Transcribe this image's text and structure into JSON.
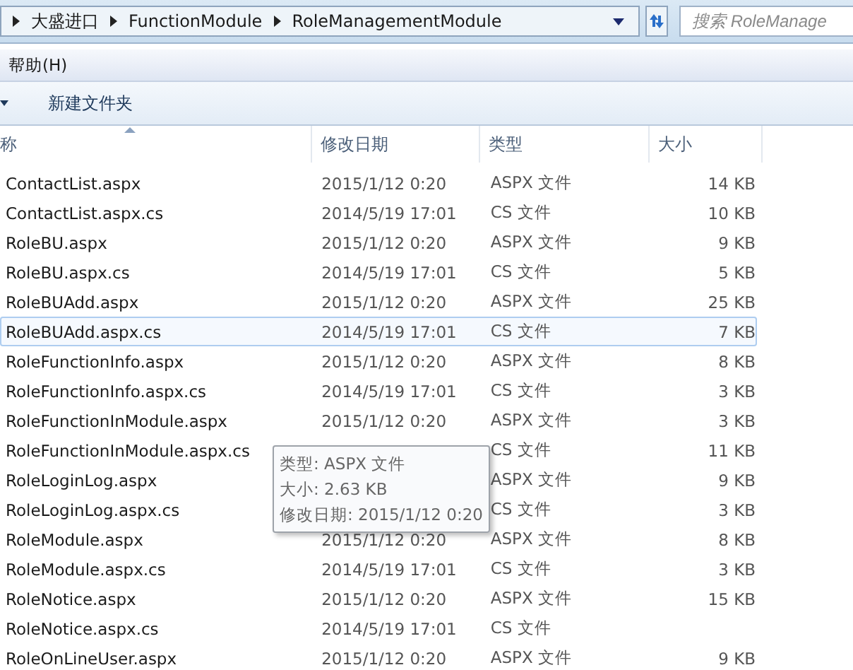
{
  "address_bar": {
    "crumbs": [
      "大盛进口",
      "FunctionModule",
      "RoleManagementModule"
    ]
  },
  "search": {
    "placeholder": "搜索 RoleManage"
  },
  "menu": [
    "帮助(H)"
  ],
  "toolbar": {
    "new_folder": "新建文件夹"
  },
  "table": {
    "columns": [
      "称",
      "修改日期",
      "类型",
      "大小"
    ],
    "rows": [
      {
        "name": "ContactList.aspx",
        "date": "2015/1/12 0:20",
        "type": "ASPX 文件",
        "size": "14 KB",
        "selected": false
      },
      {
        "name": "ContactList.aspx.cs",
        "date": "2014/5/19 17:01",
        "type": "CS 文件",
        "size": "10 KB",
        "selected": false
      },
      {
        "name": "RoleBU.aspx",
        "date": "2015/1/12 0:20",
        "type": "ASPX 文件",
        "size": "9 KB",
        "selected": false
      },
      {
        "name": "RoleBU.aspx.cs",
        "date": "2014/5/19 17:01",
        "type": "CS 文件",
        "size": "5 KB",
        "selected": false
      },
      {
        "name": "RoleBUAdd.aspx",
        "date": "2015/1/12 0:20",
        "type": "ASPX 文件",
        "size": "25 KB",
        "selected": false
      },
      {
        "name": "RoleBUAdd.aspx.cs",
        "date": "2014/5/19 17:01",
        "type": "CS 文件",
        "size": "7 KB",
        "selected": true
      },
      {
        "name": "RoleFunctionInfo.aspx",
        "date": "2015/1/12 0:20",
        "type": "ASPX 文件",
        "size": "8 KB",
        "selected": false
      },
      {
        "name": "RoleFunctionInfo.aspx.cs",
        "date": "2014/5/19 17:01",
        "type": "CS 文件",
        "size": "3 KB",
        "selected": false
      },
      {
        "name": "RoleFunctionInModule.aspx",
        "date": "2015/1/12 0:20",
        "type": "ASPX 文件",
        "size": "3 KB",
        "selected": false
      },
      {
        "name": "RoleFunctionInModule.aspx.cs",
        "type": "CS 文件",
        "size": "11 KB",
        "selected": false
      },
      {
        "name": "RoleLoginLog.aspx",
        "type": "ASPX 文件",
        "size": "9 KB",
        "selected": false
      },
      {
        "name": "RoleLoginLog.aspx.cs",
        "type": "CS 文件",
        "size": "3 KB",
        "selected": false
      },
      {
        "name": "RoleModule.aspx",
        "date": "2015/1/12 0:20",
        "type": "ASPX 文件",
        "size": "8 KB",
        "selected": false
      },
      {
        "name": "RoleModule.aspx.cs",
        "date": "2014/5/19 17:01",
        "type": "CS 文件",
        "size": "3 KB",
        "selected": false
      },
      {
        "name": "RoleNotice.aspx",
        "date": "2015/1/12 0:20",
        "type": "ASPX 文件",
        "size": "15 KB",
        "selected": false
      },
      {
        "name": "RoleNotice.aspx.cs",
        "date": "2014/5/19 17:01",
        "type": "CS 文件",
        "selected": false
      },
      {
        "name": "RoleOnLineUser.aspx",
        "date": "2015/1/12 0:20",
        "type": "ASPX 文件",
        "size": "9 KB",
        "selected": false
      }
    ]
  },
  "tooltip": {
    "lines": [
      "类型: ASPX 文件",
      "大小: 2.63 KB",
      "修改日期: 2015/1/12 0:20"
    ]
  }
}
